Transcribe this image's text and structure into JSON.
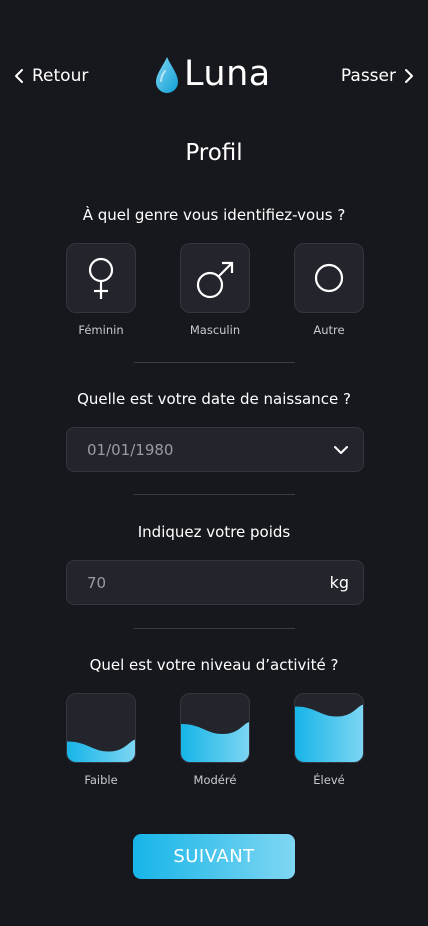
{
  "header": {
    "back_label": "Retour",
    "skip_label": "Passer",
    "logo_text": "Luna"
  },
  "page_title": "Profil",
  "gender": {
    "question": "À quel genre vous identifiez-vous ?",
    "options": [
      {
        "label": "Féminin",
        "icon": "female-icon"
      },
      {
        "label": "Masculin",
        "icon": "male-icon"
      },
      {
        "label": "Autre",
        "icon": "circle-icon"
      }
    ]
  },
  "birthdate": {
    "question": "Quelle est votre date de naissance ?",
    "value": "01/01/1980"
  },
  "weight": {
    "question": "Indiquez votre poids",
    "value": "70",
    "unit": "kg"
  },
  "activity": {
    "question": "Quel est votre niveau d’activité ?",
    "options": [
      {
        "label": "Faible",
        "level": 0.25
      },
      {
        "label": "Modéré",
        "level": 0.5
      },
      {
        "label": "Élevé",
        "level": 0.75
      }
    ]
  },
  "submit_label": "SUIVANT",
  "colors": {
    "background": "#17181d",
    "card": "#24252c",
    "accent_start": "#17b5e8",
    "accent_end": "#7fd6f2"
  }
}
